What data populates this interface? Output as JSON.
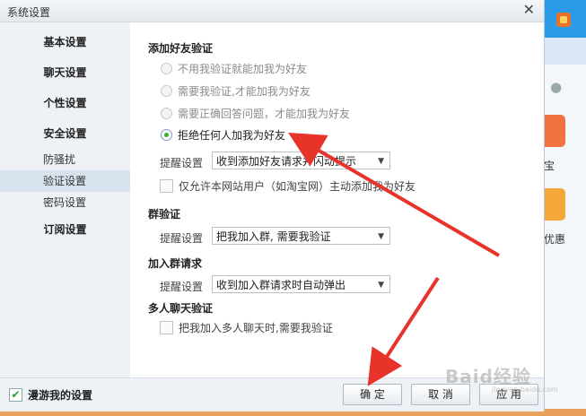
{
  "window": {
    "title": "系统设置",
    "close_glyph": "✕"
  },
  "sidebar": {
    "items": [
      {
        "label": "基本设置"
      },
      {
        "label": "聊天设置"
      },
      {
        "label": "个性设置"
      },
      {
        "label": "安全设置"
      },
      {
        "label": "防骚扰"
      },
      {
        "label": "验证设置",
        "selected": true
      },
      {
        "label": "密码设置"
      },
      {
        "label": "订阅设置"
      }
    ]
  },
  "friend_verify": {
    "title": "添加好友验证",
    "options": [
      {
        "label": "不用我验证就能加我为好友",
        "checked": false
      },
      {
        "label": "需要我验证,才能加我为好友",
        "checked": false
      },
      {
        "label": "需要正确回答问题，才能加我为好友",
        "checked": false
      },
      {
        "label": "拒绝任何人加我为好友",
        "checked": true
      }
    ],
    "remind_label": "提醒设置",
    "remind_value": "收到添加好友请求并闪动提示",
    "taobao_only": "仅允许本网站用户（如淘宝网）主动添加我为好友"
  },
  "group_verify": {
    "title": "群验证",
    "remind_label": "提醒设置",
    "remind_value": "把我加入群, 需要我验证"
  },
  "group_join": {
    "title": "加入群请求",
    "remind_label": "提醒设置",
    "remind_value": "收到加入群请求时自动弹出"
  },
  "multi_chat": {
    "title": "多人聊天验证",
    "checkbox": "把我加入多人聊天时,需要我验证"
  },
  "footer": {
    "roam_label": "漫游我的设置",
    "roam_checked": true,
    "confirm": "确 定",
    "cancel": "取 消",
    "apply": "应 用"
  },
  "background_app": {
    "label_1": "宝",
    "label_2": "优惠"
  },
  "watermark": {
    "text": "Baid经验",
    "sub": "jingyan.baidu.com"
  },
  "colors": {
    "radio_selected": "#2fb82f",
    "annotation_arrow": "#e8332a",
    "checkbox_tick": "#2aa12a"
  }
}
